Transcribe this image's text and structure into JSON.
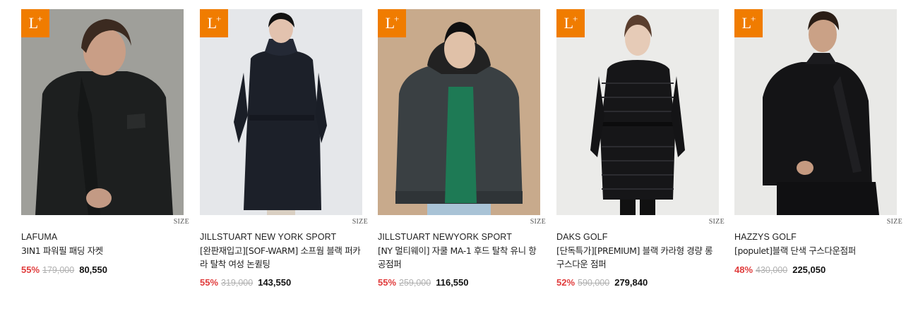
{
  "colors": {
    "badge": "#f07c00",
    "discount": "#e03c3c",
    "original_price": "#b0b0b0"
  },
  "products": [
    {
      "badge": "L",
      "badge_sup": "+",
      "size_label": "SIZE",
      "brand": "LAFUMA",
      "name": "3IN1 파워필 패딩 자켓",
      "discount": "55%",
      "original_price": "179,000",
      "price": "80,550",
      "image_bg": "#9a9a95"
    },
    {
      "badge": "L",
      "badge_sup": "+",
      "size_label": "SIZE",
      "brand": "JILLSTUART NEW YORK SPORT",
      "name": "[완판재입고][SOF-WARM] 소프웜 블랙 퍼카라 탈착 여성 논퀼팅",
      "discount": "55%",
      "original_price": "319,000",
      "price": "143,550",
      "image_bg": "#e6e8eb"
    },
    {
      "badge": "L",
      "badge_sup": "+",
      "size_label": "SIZE",
      "brand": "JILLSTUART NEWYORK SPORT",
      "name": "[NY 멀티웨이] 자쿨 MA-1 후드 탈착 유니 항공점퍼",
      "discount": "55%",
      "original_price": "259,000",
      "price": "116,550",
      "image_bg": "#c9ab8d"
    },
    {
      "badge": "L",
      "badge_sup": "+",
      "size_label": "SIZE",
      "brand": "DAKS GOLF",
      "name": "[단독특가][PREMIUM] 블랙 카라형 경량 롱 구스다운 점퍼",
      "discount": "52%",
      "original_price": "590,000",
      "price": "279,840",
      "image_bg": "#ebebe9"
    },
    {
      "badge": "L",
      "badge_sup": "+",
      "size_label": "SIZE",
      "brand": "HAZZYS GOLF",
      "name": "[populet]블랙 단색 구스다운점퍼",
      "discount": "48%",
      "original_price": "430,000",
      "price": "225,050",
      "image_bg": "#e9e9e7"
    }
  ]
}
